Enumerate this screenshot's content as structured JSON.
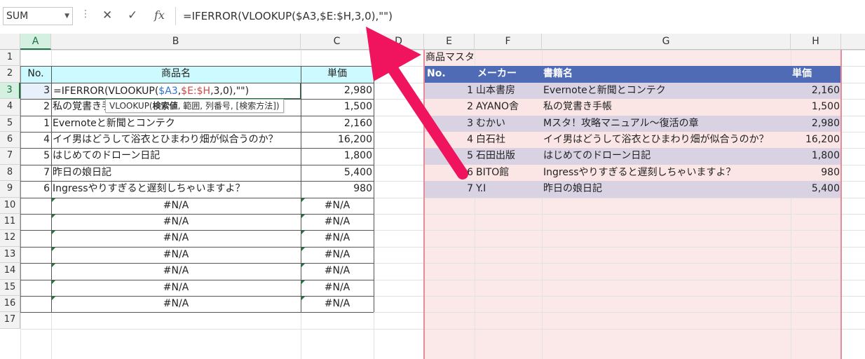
{
  "formula_bar": {
    "name_box": "SUM",
    "cancel_glyph": "✕",
    "enter_glyph": "✓",
    "fx_label": "fx",
    "formula": "=IFERROR(VLOOKUP($A3,$E:$H,3,0),\"\")"
  },
  "columns": [
    "A",
    "B",
    "C",
    "D",
    "E",
    "F",
    "G",
    "H"
  ],
  "rows": [
    "1",
    "2",
    "3",
    "4",
    "5",
    "6",
    "7",
    "8",
    "9",
    "10",
    "11",
    "12",
    "13",
    "14",
    "15",
    "16",
    "17"
  ],
  "order_table": {
    "headers": {
      "no": "No.",
      "name": "商品名",
      "price": "単価"
    },
    "editing_cell": {
      "prefix": "=IFERROR(VLOOKUP(",
      "ref1": "$A3",
      "comma1": ",",
      "ref2": "$E:$H",
      "suffix": ",3,0),\"\")"
    },
    "rows": [
      {
        "no": "3",
        "name": "",
        "price": "2,980"
      },
      {
        "no": "2",
        "name": "私の覚書き手帳",
        "price": "1,500"
      },
      {
        "no": "1",
        "name": "Evernoteと新聞とコンテク",
        "price": "2,160"
      },
      {
        "no": "4",
        "name": "イイ男はどうして浴衣とひまわり畑が似合うのか？",
        "price": "16,200"
      },
      {
        "no": "5",
        "name": "はじめてのドローン日記",
        "price": "1,800"
      },
      {
        "no": "7",
        "name": "昨日の娘日記",
        "price": "5,400"
      },
      {
        "no": "6",
        "name": "Ingressやりすぎると遅刻しちゃいますよ？",
        "price": "980"
      },
      {
        "no": "",
        "name": "#N/A",
        "price": "#N/A"
      },
      {
        "no": "",
        "name": "#N/A",
        "price": "#N/A"
      },
      {
        "no": "",
        "name": "#N/A",
        "price": "#N/A"
      },
      {
        "no": "",
        "name": "#N/A",
        "price": "#N/A"
      },
      {
        "no": "",
        "name": "#N/A",
        "price": "#N/A"
      },
      {
        "no": "",
        "name": "#N/A",
        "price": "#N/A"
      },
      {
        "no": "",
        "name": "#N/A",
        "price": "#N/A"
      }
    ]
  },
  "tooltip": {
    "func": "VLOOKUP(",
    "arg1": "検索値",
    "rest": ", 範囲, 列番号, [検索方法])"
  },
  "master_table": {
    "title": "商品マスタ",
    "headers": {
      "no": "No.",
      "maker": "メーカー",
      "title": "書籍名",
      "price": "単価"
    },
    "rows": [
      {
        "no": "1",
        "maker": "山本書房",
        "title": "Evernoteと新聞とコンテク",
        "price": "2,160"
      },
      {
        "no": "2",
        "maker": "AYANO舎",
        "title": "私の覚書き手帳",
        "price": "1,500"
      },
      {
        "no": "3",
        "maker": "むかい",
        "title": "Mスタ！攻略マニュアル〜復活の章",
        "price": "2,980"
      },
      {
        "no": "4",
        "maker": "白石社",
        "title": "イイ男はどうして浴衣とひまわり畑が似合うのか？",
        "price": "16,200"
      },
      {
        "no": "5",
        "maker": "石田出版",
        "title": "はじめてのドローン日記",
        "price": "1,800"
      },
      {
        "no": "6",
        "maker": "BITO館",
        "title": "Ingressやりすぎると遅刻しちゃいますよ？",
        "price": "980"
      },
      {
        "no": "7",
        "maker": "Y.I",
        "title": "昨日の娘日記",
        "price": "5,400"
      }
    ]
  },
  "colors": {
    "accent_green": "#217346",
    "header_cyan": "#ccfaff",
    "master_header": "#4f6bb5",
    "master_row_purple": "#d8d2e3",
    "master_row_pink": "#fbe5e5",
    "ref_blue": "#2e6fd8",
    "ref_red": "#d04a4a",
    "arrow_magenta": "#f0145e"
  }
}
